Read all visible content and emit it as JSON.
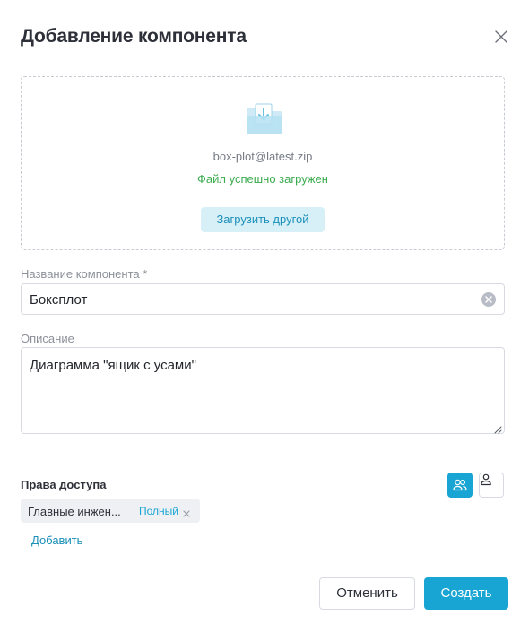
{
  "dialog": {
    "title": "Добавление компонента",
    "close_icon": "close-icon"
  },
  "upload": {
    "icon": "folder-icon",
    "file_name": "box-plot@latest.zip",
    "status": "Файл успешно загружен",
    "upload_other_label": "Загрузить другой"
  },
  "name_field": {
    "label": "Название компонента *",
    "value": "Боксплот"
  },
  "description_field": {
    "label": "Описание",
    "value": "Диаграмма \"ящик с усами\""
  },
  "access": {
    "title": "Права доступа",
    "group_icon": "group-icon",
    "user_icon": "user-icon",
    "items": [
      {
        "name": "Главные инжен...",
        "level": "Полный"
      }
    ],
    "add_label": "Добавить"
  },
  "actions": {
    "cancel_label": "Отменить",
    "create_label": "Создать"
  },
  "colors": {
    "accent": "#19a5d3",
    "success": "#3bab4f",
    "accent_light": "#d7f0f8"
  }
}
